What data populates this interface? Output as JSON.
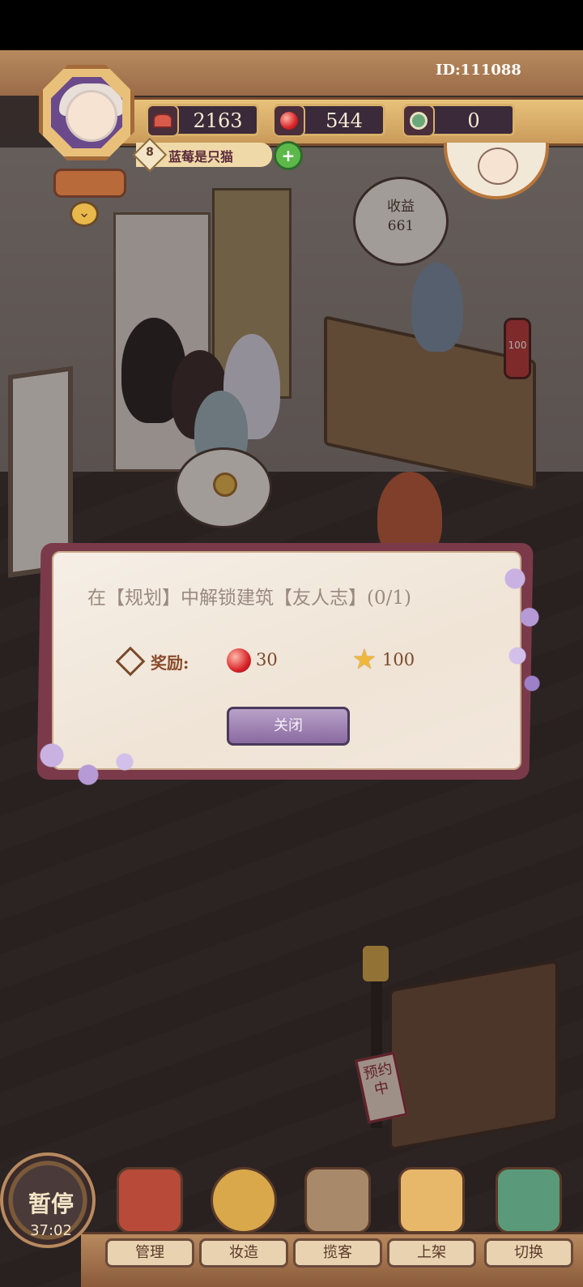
{
  "hud": {
    "player_id": "ID:111088",
    "level": "8",
    "player_name": "蓝莓是只猫",
    "resources": [
      {
        "icon": "cake-icon",
        "value": "2163"
      },
      {
        "icon": "red-gem-icon",
        "value": "544"
      },
      {
        "icon": "clock-token-icon",
        "value": "0"
      }
    ]
  },
  "scene": {
    "income_bubble": {
      "label": "收益",
      "value": "661"
    },
    "counter_tag": "100",
    "reserved_sign": "预约中"
  },
  "dialog": {
    "task_text": "在【规划】中解锁建筑【友人志】(0/1)",
    "reward_label": "奖励:",
    "rewards": [
      {
        "icon": "red-gem-icon",
        "value": "30"
      },
      {
        "icon": "star-icon",
        "value": "100"
      }
    ],
    "close_label": "关闭"
  },
  "bottom_bar": {
    "pause_label": "暂停",
    "timer": "37:02",
    "nav": [
      {
        "label": "管理"
      },
      {
        "label": "妆造"
      },
      {
        "label": "揽客"
      },
      {
        "label": "上架"
      },
      {
        "label": "切换"
      }
    ]
  },
  "colors": {
    "dialog_frame": "#7a3a4a",
    "close_button": "#8a6aa0",
    "hud_gold": "#d9b06a"
  }
}
